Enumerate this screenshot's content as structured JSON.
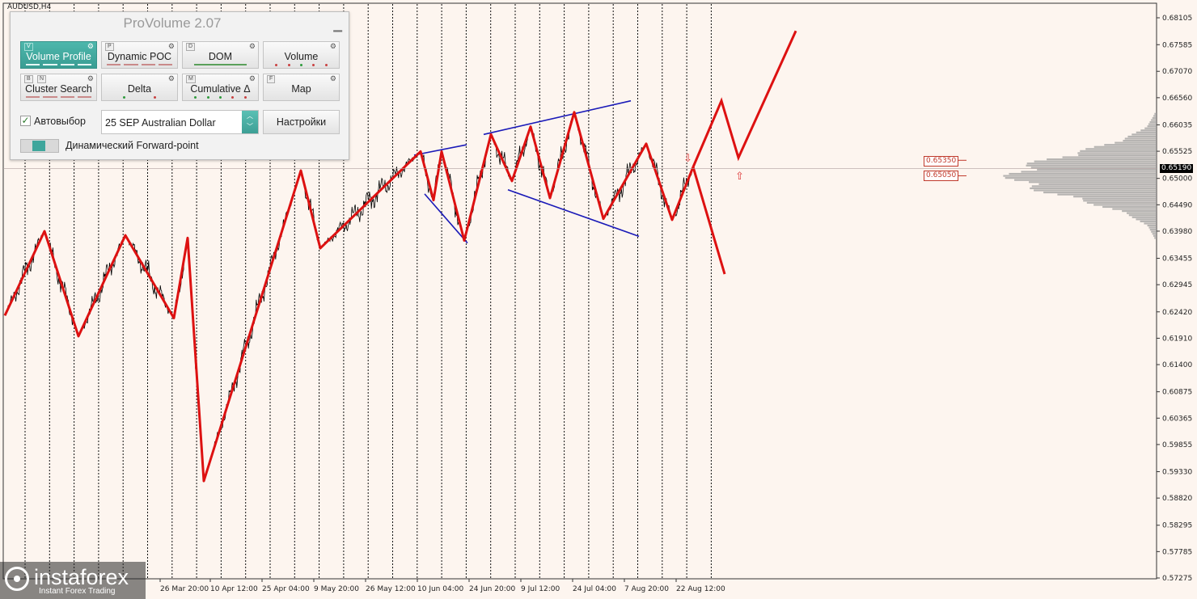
{
  "window": {
    "symbol": "AUDUSD,H4"
  },
  "panel": {
    "title": "ProVolume 2.07",
    "minimize_icon": "minimize-icon",
    "buttons": [
      {
        "key": "V",
        "label": "Volume Profile",
        "active": true
      },
      {
        "key": "P",
        "label": "Dynamic POC",
        "active": false
      },
      {
        "key": "D",
        "label": "DOM",
        "active": false
      },
      {
        "key": "",
        "label": "Volume",
        "active": false
      },
      {
        "key": "B",
        "key2": "N",
        "label": "Cluster Search",
        "active": false
      },
      {
        "key": "",
        "label": "Delta",
        "active": false
      },
      {
        "key": "M",
        "label": "Cumulative Δ",
        "active": false
      },
      {
        "key": "F",
        "label": "Map",
        "active": false
      }
    ],
    "auto_select": {
      "label": "Автовыбор",
      "checked": true
    },
    "contract": {
      "value": "25 SEP Australian Dollar"
    },
    "settings_label": "Настройки",
    "forward_point": {
      "label": "Динамический Forward-point",
      "enabled": true
    }
  },
  "price_axis": {
    "labels": [
      "0.68105",
      "0.67585",
      "0.67070",
      "0.66560",
      "0.66035",
      "0.65525",
      "0.65000",
      "0.64490",
      "0.63980",
      "0.63455",
      "0.62945",
      "0.62420",
      "0.61910",
      "0.61400",
      "0.60875",
      "0.60365",
      "0.59855",
      "0.59330",
      "0.58820",
      "0.58295",
      "0.57785",
      "0.57275"
    ],
    "current_price": "0.65190",
    "level_a": "0.65350",
    "level_b": "0.65050"
  },
  "time_axis": {
    "labels": [
      "26 Mar 20:00",
      "10 Apr 12:00",
      "25 Apr 04:00",
      "9 May 20:00",
      "26 May 12:00",
      "10 Jun 04:00",
      "24 Jun 20:00",
      "9 Jul 12:00",
      "24 Jul 04:00",
      "7 Aug 20:00",
      "22 Aug 12:00"
    ]
  },
  "logo": {
    "name": "instaforex",
    "tagline": "Instant Forex Trading"
  },
  "colors": {
    "background": "#fdf5ef",
    "zigzag": "#dd1111",
    "channel": "#1a1ab8",
    "profile": "#9e9e9e",
    "accent": "#3fa69c"
  },
  "chart_data": {
    "type": "line",
    "title": "AUDUSD,H4",
    "ylim": [
      0.57275,
      0.68105
    ],
    "zigzag_prices": [
      0.6235,
      0.6398,
      0.6195,
      0.639,
      0.623,
      0.6385,
      0.5915,
      0.6515,
      0.6365,
      0.6552,
      0.6458,
      0.6552,
      0.638,
      0.6585,
      0.6495,
      0.66,
      0.6462,
      0.6628,
      0.6422,
      0.6567,
      0.642,
      0.6522
    ],
    "forecast_prices": [
      0.665,
      0.654,
      0.6785
    ],
    "forecast_down_price": 0.6315,
    "levels": [
      0.6535,
      0.6505
    ]
  }
}
